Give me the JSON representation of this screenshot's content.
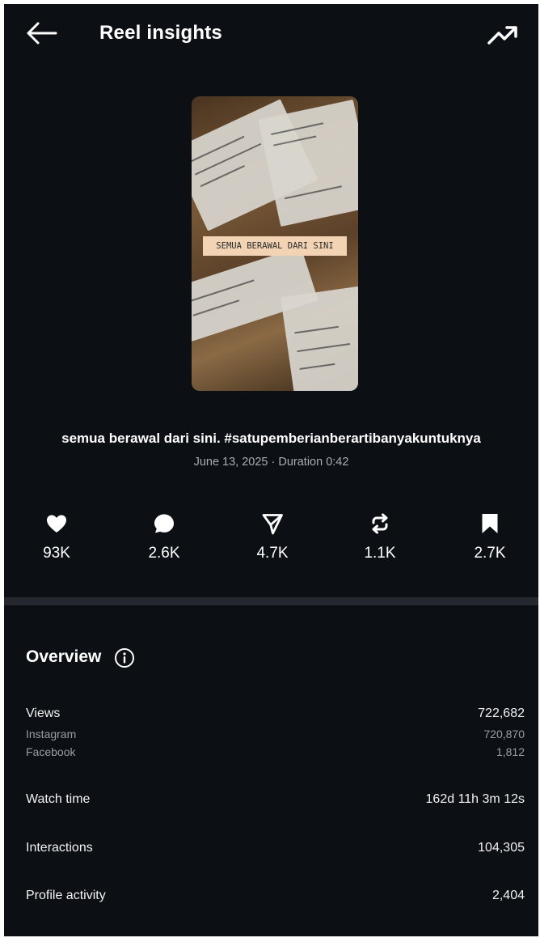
{
  "header": {
    "title": "Reel insights",
    "back_icon": "arrow-left-icon",
    "trend_icon": "trending-up-icon"
  },
  "reel": {
    "thumbnail_text": "SEMUA BERAWAL DARI SINI",
    "caption": "semua berawal dari sini. #satupemberianberartibanyakuntuknya",
    "meta": "June 13, 2025 · Duration 0:42"
  },
  "stats": {
    "likes": "93K",
    "comments": "2.6K",
    "shares": "4.7K",
    "reposts": "1.1K",
    "saves": "2.7K"
  },
  "overview": {
    "title": "Overview",
    "views_label": "Views",
    "views_value": "722,682",
    "instagram_label": "Instagram",
    "instagram_value": "720,870",
    "facebook_label": "Facebook",
    "facebook_value": "1,812",
    "watch_time_label": "Watch time",
    "watch_time_value": "162d 11h 3m 12s",
    "interactions_label": "Interactions",
    "interactions_value": "104,305",
    "profile_activity_label": "Profile activity",
    "profile_activity_value": "2,404"
  },
  "colors": {
    "background": "#0c0f14",
    "divider": "#25282e",
    "text": "#ffffff",
    "muted": "#9a9ea4"
  }
}
